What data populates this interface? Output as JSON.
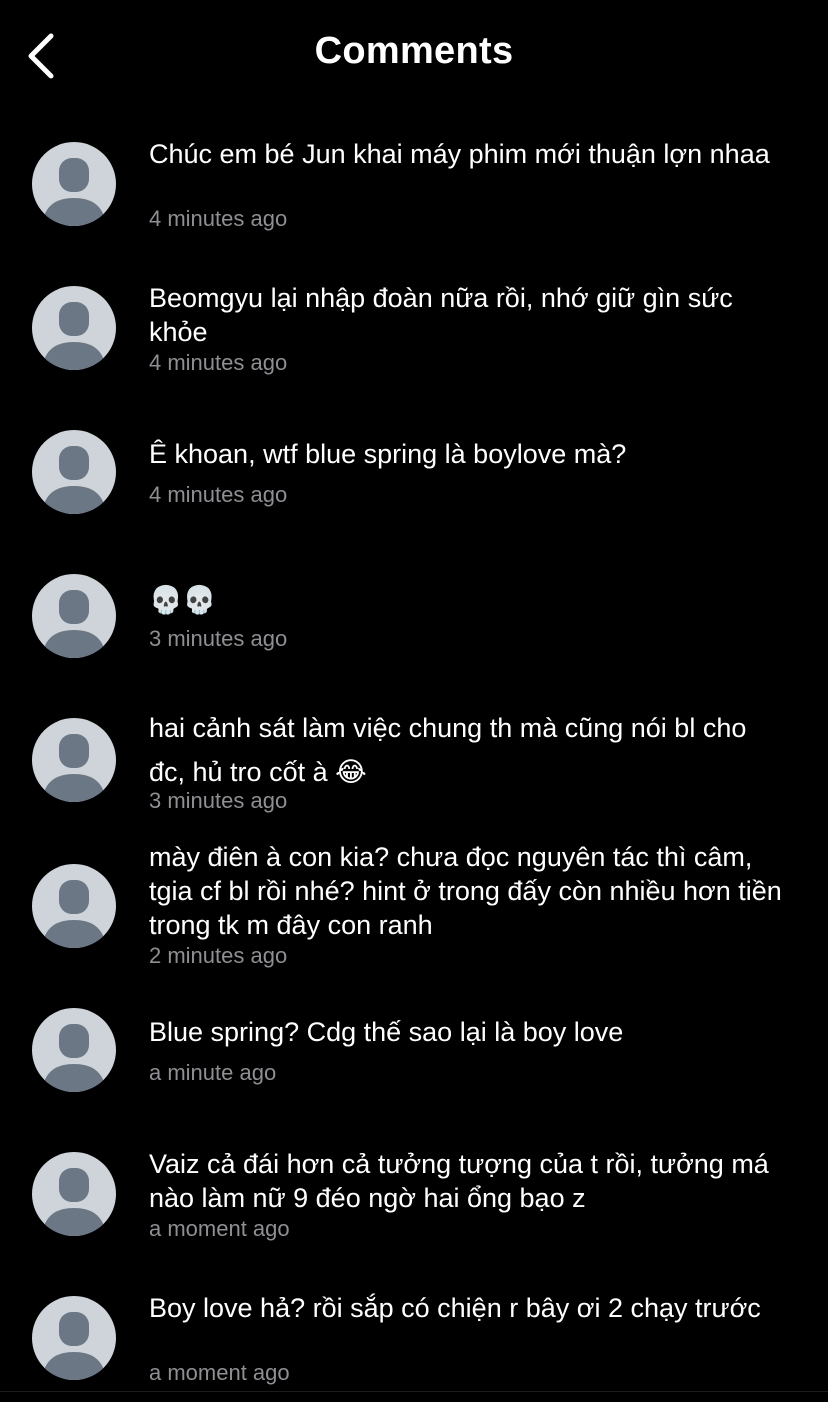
{
  "header": {
    "title": "Comments"
  },
  "comments": [
    {
      "text": "Chúc em bé Jun khai máy phim mới thuận lợn nhaa",
      "time": "4 minutes ago"
    },
    {
      "text": "Beomgyu lại nhập đoàn nữa rồi, nhớ giữ gìn sức khỏe",
      "time": "4 minutes ago"
    },
    {
      "text": "Ê khoan, wtf blue spring là boylove mà?",
      "time": "4 minutes ago"
    },
    {
      "text": "💀💀",
      "time": "3 minutes ago"
    },
    {
      "text": "hai cảnh sát làm việc chung th mà cũng nói bl cho đc, hủ tro cốt à 😂",
      "time": "3 minutes ago"
    },
    {
      "text": "mày điên à con kia? chưa đọc nguyên tác thì câm, tgia cf bl rồi nhé? hint ở trong đấy còn nhiều hơn tiền trong tk m đây con ranh",
      "time": "2 minutes ago"
    },
    {
      "text": "Blue spring? Cdg thế sao lại là boy love",
      "time": "a minute ago"
    },
    {
      "text": "Vaiz cả đái hơn cả tưởng tượng của t rồi, tưởng má nào làm nữ 9 đéo ngờ hai ổng bạo z",
      "time": "a moment ago"
    },
    {
      "text": "Boy love hả? rồi sắp có chiện r bây ơi 2 chạy trước",
      "time": "a moment ago"
    }
  ],
  "colors": {
    "background": "#000000",
    "text": "#ffffff",
    "timestamp": "#8e8e93",
    "avatar_bg": "#cfd4da",
    "avatar_fg": "#6b7785"
  },
  "icons": {
    "back": "chevron-left-icon",
    "avatar": "default-user-avatar-icon"
  }
}
